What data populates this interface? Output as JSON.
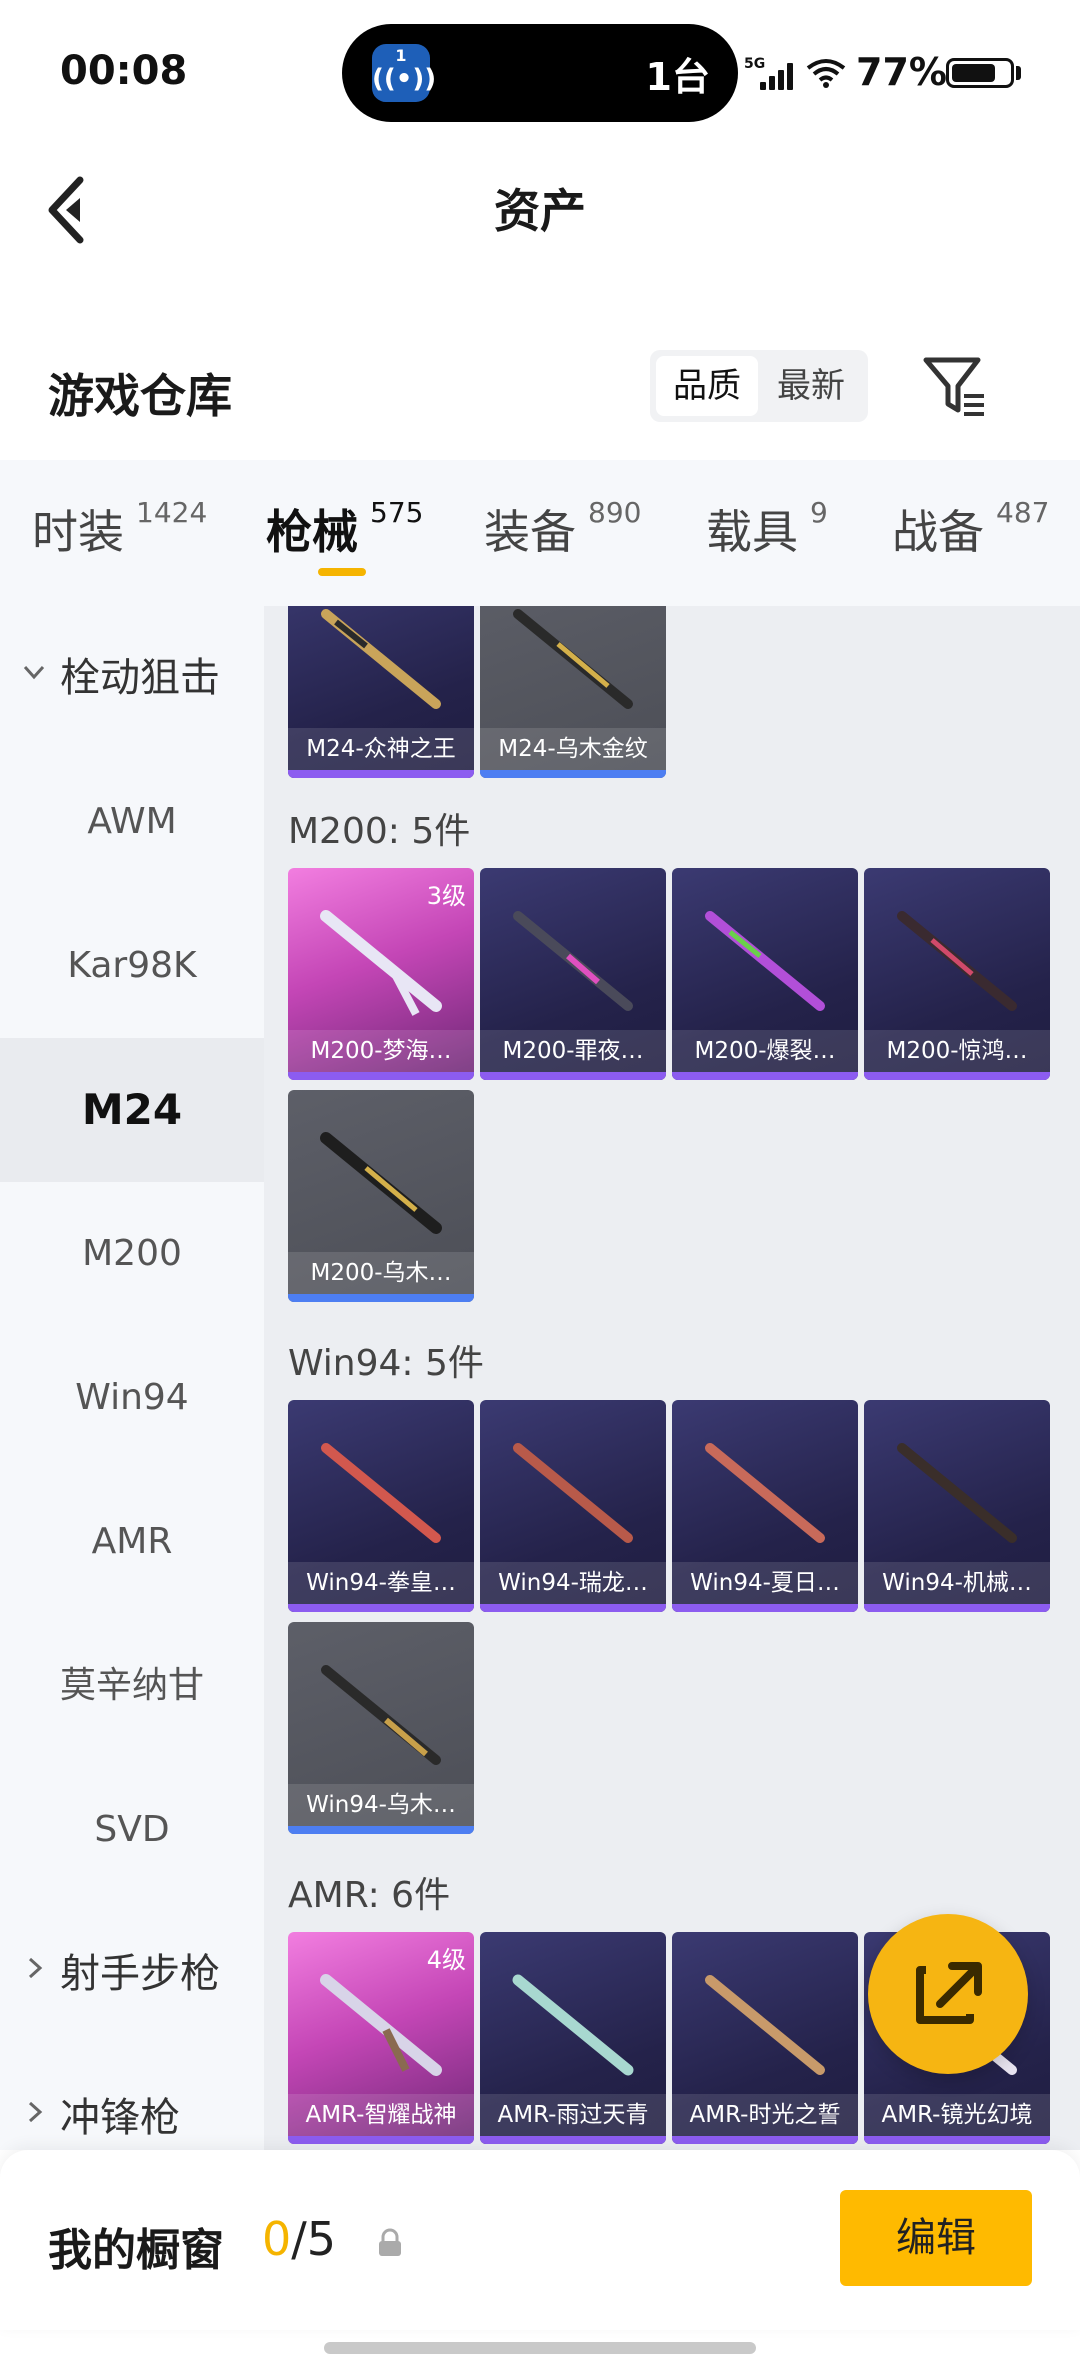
{
  "status": {
    "time": "00:08",
    "island_count": "1台",
    "island_app_num": "1",
    "island_app_glyph": "((•))",
    "network": "5G",
    "battery_pct": "77%",
    "battery_level": 0.77
  },
  "nav": {
    "title": "资产"
  },
  "warehouse": {
    "title": "游戏仓库",
    "sort_options": [
      "品质",
      "最新"
    ],
    "active_sort": "品质"
  },
  "tabs": [
    {
      "label": "时装",
      "count": "1424"
    },
    {
      "label": "枪械",
      "count": "575"
    },
    {
      "label": "装备",
      "count": "890"
    },
    {
      "label": "载具",
      "count": "9"
    },
    {
      "label": "战备",
      "count": "487"
    }
  ],
  "sidebar": {
    "groups": [
      "栓动狙击",
      "射手步枪",
      "冲锋枪"
    ],
    "items": [
      "AWM",
      "Kar98K",
      "M24",
      "M200",
      "Win94",
      "AMR",
      "莫辛纳甘",
      "SVD"
    ],
    "active": "M24"
  },
  "sections": {
    "m24": {
      "cards": [
        "M24-众神之王",
        "M24-乌木金纹"
      ]
    },
    "m200": {
      "label": "M200: 5件",
      "cards": [
        "M200-梦海…",
        "M200-罪夜…",
        "M200-爆裂…",
        "M200-惊鸿…",
        "M200-乌木…"
      ],
      "level": "3级"
    },
    "win94": {
      "label": "Win94: 5件",
      "cards": [
        "Win94-拳皇…",
        "Win94-瑞龙…",
        "Win94-夏日…",
        "Win94-机械…",
        "Win94-乌木…"
      ]
    },
    "amr": {
      "label": "AMR: 6件",
      "cards": [
        "AMR-智耀战神",
        "AMR-雨过天青",
        "AMR-时光之誓",
        "AMR-镜光幻境"
      ],
      "level": "4级"
    }
  },
  "showcase": {
    "title": "我的橱窗",
    "current": "0",
    "total": "/5",
    "edit_label": "编辑"
  },
  "colors": {
    "accent": "#f5b400",
    "card_purple": "#2c2a5a",
    "card_gray": "#55575f",
    "card_pink": "#d35bc6"
  }
}
